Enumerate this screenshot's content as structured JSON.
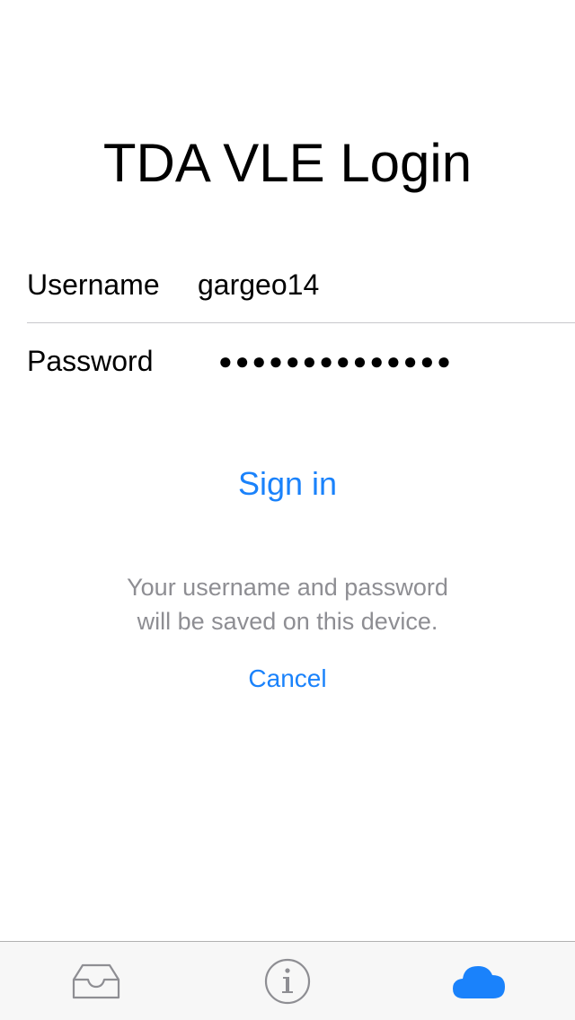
{
  "login": {
    "title": "TDA VLE Login",
    "username_label": "Username",
    "username_value": "gargeo14",
    "password_label": "Password",
    "password_mask": "●●●●●●●●●●●●●●",
    "signin_label": "Sign in",
    "note_line1": "Your username and password",
    "note_line2": "will be saved on this device.",
    "cancel_label": "Cancel"
  },
  "tabbar": {
    "tabs": [
      {
        "icon": "inbox-icon",
        "active": false
      },
      {
        "icon": "info-icon",
        "active": false
      },
      {
        "icon": "cloud-icon",
        "active": true
      }
    ]
  },
  "colors": {
    "accent": "#1a82fb",
    "inactive_icon": "#8e8e93",
    "note_text": "#8e8e93"
  }
}
